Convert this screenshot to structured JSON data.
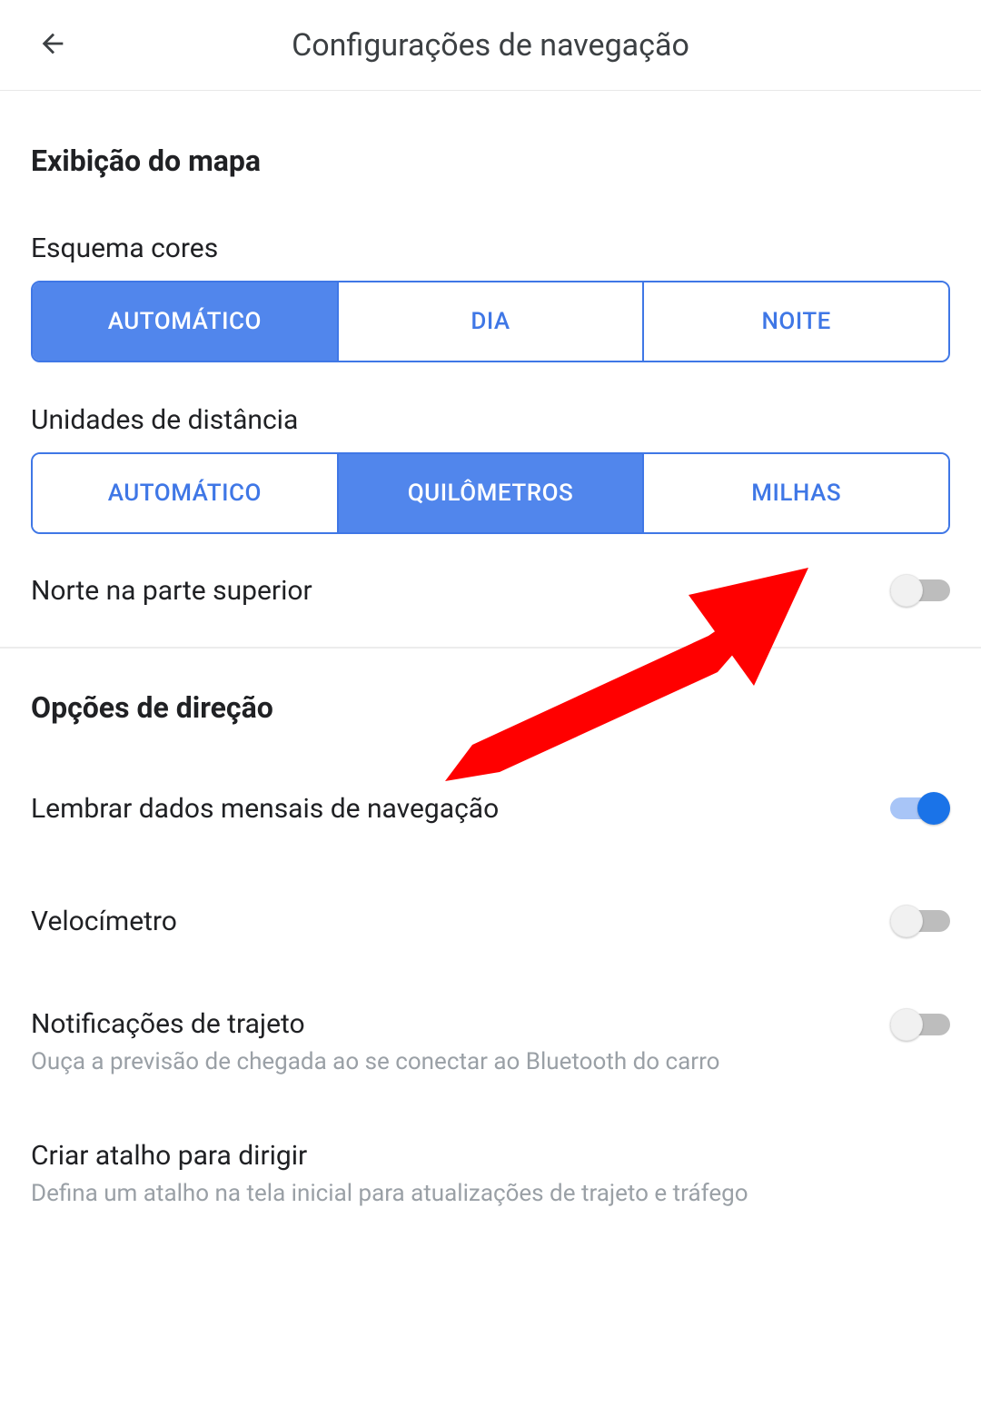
{
  "header": {
    "title": "Configurações de navegação"
  },
  "sections": {
    "mapDisplay": {
      "header": "Exibição do mapa",
      "colorScheme": {
        "label": "Esquema cores",
        "options": {
          "auto": "AUTOMÁTICO",
          "day": "DIA",
          "night": "NOITE"
        },
        "selected": "auto"
      },
      "distanceUnits": {
        "label": "Unidades de distância",
        "options": {
          "auto": "AUTOMÁTICO",
          "km": "QUILÔMETROS",
          "mi": "MILHAS"
        },
        "selected": "km"
      },
      "northUp": {
        "label": "Norte na parte superior",
        "value": false
      }
    },
    "driving": {
      "header": "Opções de direção",
      "rememberMonthly": {
        "label": "Lembrar dados mensais de navegação",
        "value": true
      },
      "speedometer": {
        "label": "Velocímetro",
        "value": false
      },
      "tripNotifications": {
        "label": "Notificações de trajeto",
        "sub": "Ouça a previsão de chegada ao se conectar ao Bluetooth do carro",
        "value": false
      },
      "shortcut": {
        "label": "Criar atalho para dirigir",
        "sub": "Defina um atalho na tela inicial para atualizações de trajeto e tráfego"
      }
    }
  }
}
